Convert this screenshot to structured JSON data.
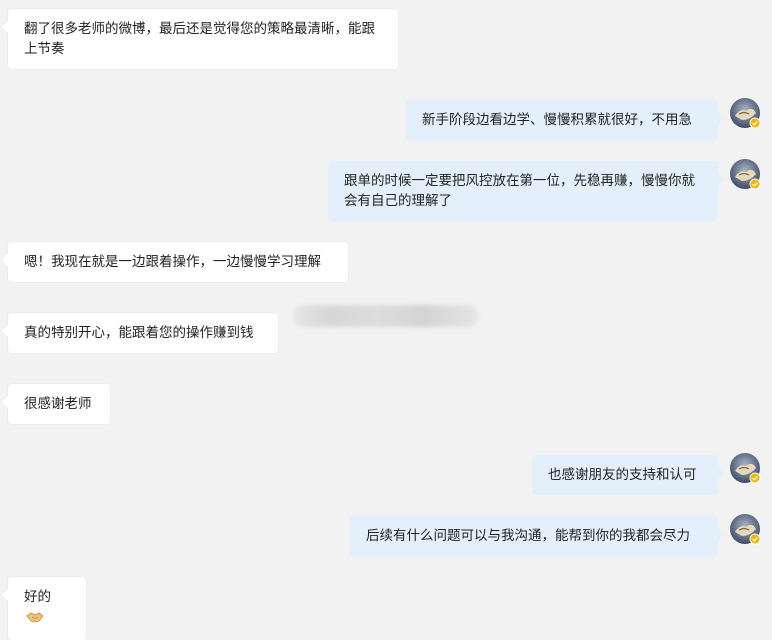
{
  "messages": [
    {
      "side": "incoming",
      "text": "翻了很多老师的微博，最后还是觉得您的策略最清晰，能跟上节奏"
    },
    {
      "side": "outgoing",
      "text": "新手阶段边看边学、慢慢积累就很好，不用急"
    },
    {
      "side": "outgoing",
      "text": "跟单的时候一定要把风控放在第一位，先稳再赚，慢慢你就会有自己的理解了"
    },
    {
      "side": "incoming",
      "text": "嗯！我现在就是一边跟着操作，一边慢慢学习理解"
    },
    {
      "side": "incoming",
      "text": "真的特别开心，能跟着您的操作赚到钱"
    },
    {
      "side": "incoming",
      "text": "很感谢老师"
    },
    {
      "side": "outgoing",
      "text": "也感谢朋友的支持和认可"
    },
    {
      "side": "outgoing",
      "text": "后续有什么问题可以与我沟通，能帮到你的我都会尽力"
    },
    {
      "side": "incoming",
      "text": "好的",
      "emoji": "handshake-emoji"
    }
  ],
  "colors": {
    "background": "#f2f2f2",
    "incoming_bubble": "#ffffff",
    "outgoing_bubble": "#e3f0fb",
    "verified_badge": "#f5b400"
  },
  "icons": {
    "avatar": "teacher-avatar-icon",
    "badge": "verified-badge-icon"
  }
}
